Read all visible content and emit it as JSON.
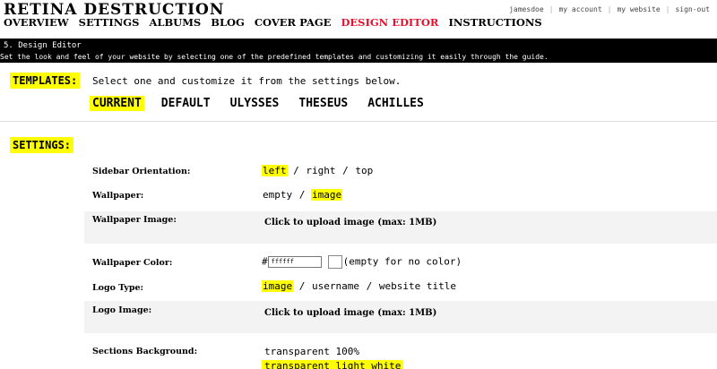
{
  "site_title": "RETINA DESTRUCTION",
  "nav": [
    "OVERVIEW",
    "SETTINGS",
    "ALBUMS",
    "BLOG",
    "COVER PAGE",
    "DESIGN EDITOR",
    "INSTRUCTIONS"
  ],
  "user_links": {
    "username": "jamesdoe",
    "my_account": "my account",
    "my_website": "my website",
    "sign_out": "sign-out",
    "separator": "|"
  },
  "bar": {
    "title": "5. Design Editor",
    "description": "Set the look and feel of your website by selecting one of the predefined templates and customizing it easily through the guide."
  },
  "templates": {
    "label": "TEMPLATES:",
    "description": "Select one and customize it from the settings below.",
    "items": [
      "CURRENT",
      "DEFAULT",
      "ULYSSES",
      "THESEUS",
      "ACHILLES"
    ],
    "selected": "CURRENT"
  },
  "settings": {
    "label": "SETTINGS:",
    "separator": "/",
    "sidebar_orientation": {
      "label": "Sidebar Orientation:",
      "options": [
        "left",
        "right",
        "top"
      ],
      "selected": "left"
    },
    "wallpaper": {
      "label": "Wallpaper:",
      "options": [
        "empty",
        "image"
      ],
      "selected": "image"
    },
    "wallpaper_image": {
      "label": "Wallpaper Image:",
      "upload_text": "Click to upload image (max: 1MB)"
    },
    "wallpaper_color": {
      "label": "Wallpaper Color:",
      "hash": "#",
      "value": "ffffff",
      "note": "(empty for no color)"
    },
    "logo_type": {
      "label": "Logo Type:",
      "options": [
        "image",
        "username",
        "website title"
      ],
      "selected": "image"
    },
    "logo_image": {
      "label": "Logo Image:",
      "upload_text": "Click to upload image (max: 1MB)"
    },
    "sections_background": {
      "label": "Sections Background:",
      "options": [
        "transparent 100%",
        "transparent light white"
      ]
    }
  },
  "colors": {
    "highlight": "#ffff00",
    "active_nav": "#e8112d",
    "bar_bg": "#000000",
    "row_bg": "#f3f3f3"
  }
}
